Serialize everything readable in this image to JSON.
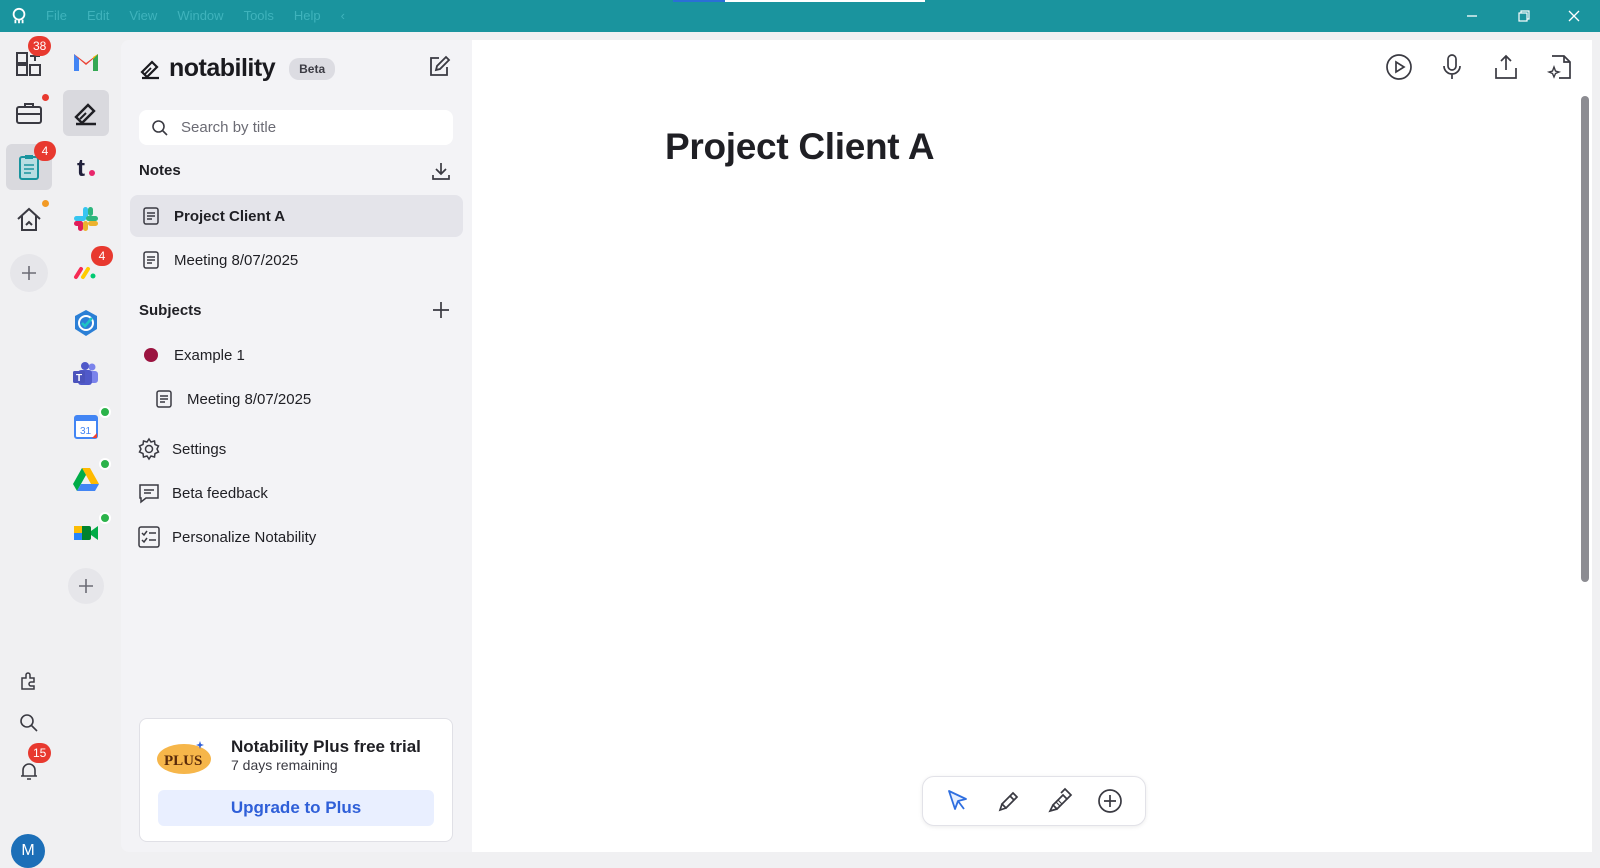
{
  "menu": [
    "File",
    "Edit",
    "View",
    "Window",
    "Tools",
    "Help"
  ],
  "dock_left": {
    "badges": {
      "apps": "38",
      "clipboard": "4",
      "notifications": "15"
    },
    "avatar_initial": "M"
  },
  "dock_apps": {
    "monday_badge": "4",
    "calendar_day": "31"
  },
  "sidebar": {
    "brand": "notability",
    "beta": "Beta",
    "search_placeholder": "Search by title",
    "notes_header": "Notes",
    "notes": [
      "Project Client A",
      "Meeting 8/07/2025"
    ],
    "subjects_header": "Subjects",
    "subject": "Example 1",
    "subject_note": "Meeting 8/07/2025",
    "settings": "Settings",
    "feedback": "Beta feedback",
    "personalize": "Personalize Notability",
    "promo": {
      "badge": "PLUS",
      "title": "Notability Plus free trial",
      "subtitle": "7 days remaining",
      "button": "Upgrade to Plus"
    }
  },
  "main": {
    "title": "Project Client A"
  },
  "colors": {
    "titlebar": "#1a949e",
    "subject_dot": "#9b1340",
    "badge": "#e8392f",
    "upgrade_text": "#2f5fd8",
    "selection_blue": "#2f6fe0"
  }
}
